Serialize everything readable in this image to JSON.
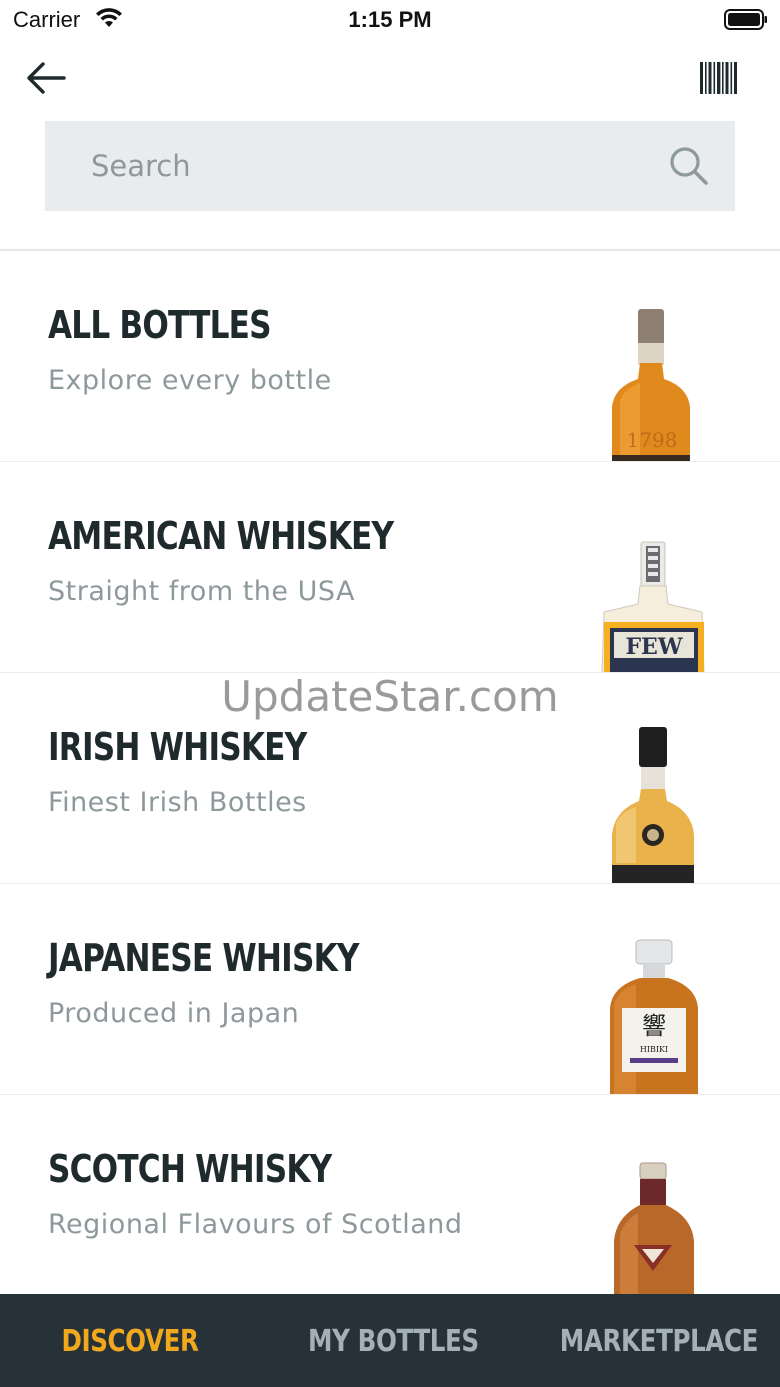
{
  "status_bar": {
    "carrier": "Carrier",
    "time": "1:15 PM"
  },
  "nav": {
    "back_icon": "arrow-left-icon",
    "barcode_icon": "barcode-icon"
  },
  "search": {
    "placeholder": "Search",
    "icon": "search-icon"
  },
  "categories": [
    {
      "title": "ALL BOTTLES",
      "subtitle": "Explore every bottle",
      "image": "bottle-all-bottles"
    },
    {
      "title": "AMERICAN WHISKEY",
      "subtitle": "Straight from the USA",
      "image": "bottle-american-whiskey",
      "bottle_label": "FEW"
    },
    {
      "title": "IRISH WHISKEY",
      "subtitle": "Finest Irish Bottles",
      "image": "bottle-irish-whiskey"
    },
    {
      "title": "JAPANESE WHISKY",
      "subtitle": "Produced in Japan",
      "image": "bottle-japanese-whisky",
      "bottle_label": "HIBIKI"
    },
    {
      "title": "SCOTCH WHISKY",
      "subtitle": "Regional Flavours of Scotland",
      "image": "bottle-scotch-whisky"
    }
  ],
  "watermark": "UpdateStar.com",
  "tabs": [
    {
      "label": "DISCOVER",
      "active": true
    },
    {
      "label": "MY BOTTLES",
      "active": false
    },
    {
      "label": "MARKETPLACE",
      "active": false
    }
  ],
  "colors": {
    "tab_bar_bg": "#263238",
    "tab_active": "#f2a81d",
    "tab_inactive": "#a4b0b4",
    "search_bg": "#e9ecec",
    "title_text": "#1f2a2d",
    "subtitle_text": "#8e999c"
  }
}
